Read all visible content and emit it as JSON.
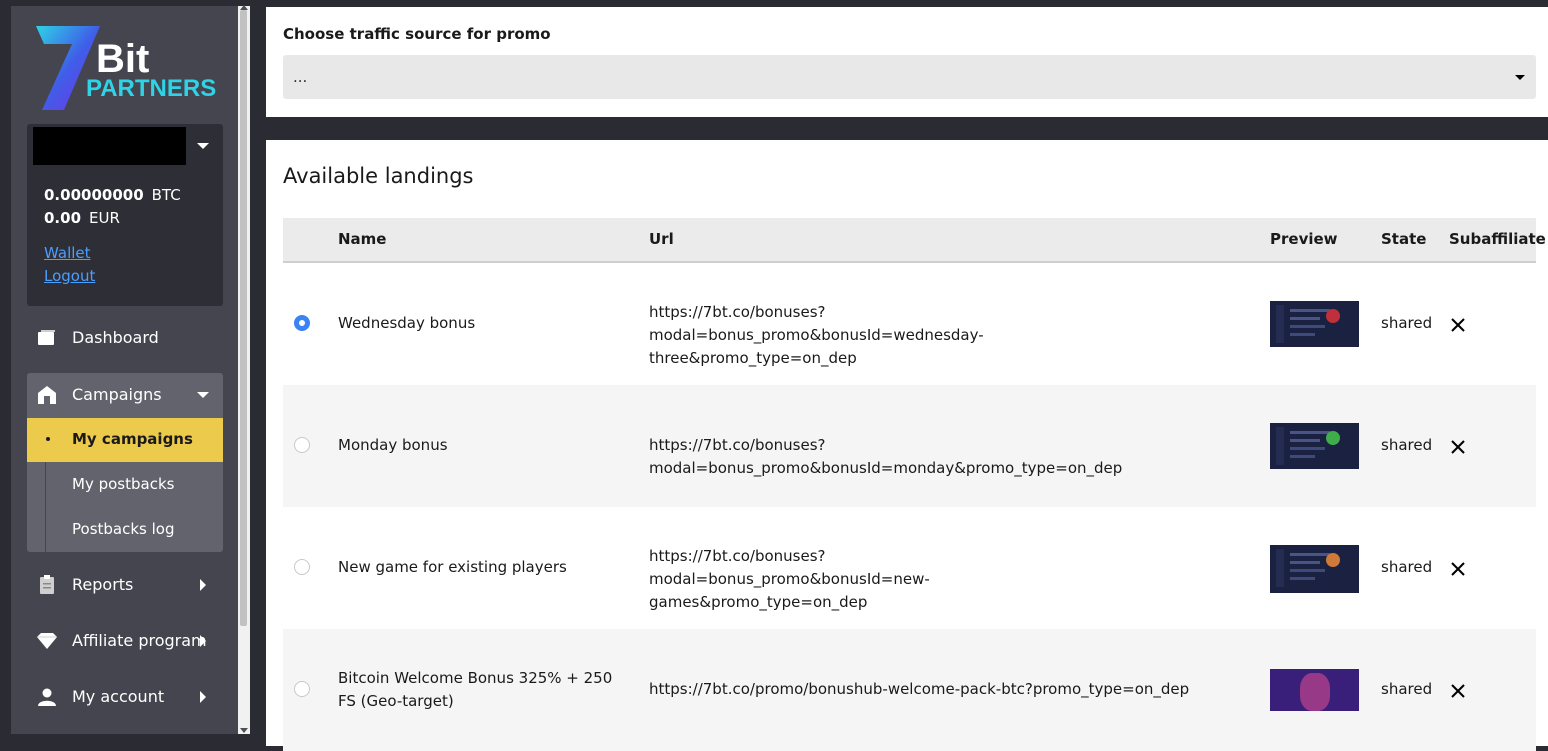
{
  "sidebar": {
    "logo": {
      "line1": "Bit",
      "line2": "PARTNERS",
      "mark": "7"
    },
    "account": {
      "btc_amount": "0.00000000",
      "btc_currency": "BTC",
      "eur_amount": "0.00",
      "eur_currency": "EUR",
      "wallet_link": "Wallet",
      "logout_link": "Logout"
    },
    "nav": {
      "dashboard": "Dashboard",
      "campaigns": "Campaigns",
      "my_campaigns": "My campaigns",
      "my_postbacks": "My postbacks",
      "postbacks_log": "Postbacks log",
      "reports": "Reports",
      "affiliate_program": "Affiliate program",
      "my_account": "My account"
    }
  },
  "traffic": {
    "label": "Choose traffic source for promo",
    "selected": "..."
  },
  "landings": {
    "title": "Available landings",
    "columns": {
      "name": "Name",
      "url": "Url",
      "preview": "Preview",
      "state": "State",
      "subaffiliate": "Subaffiliate"
    },
    "rows": [
      {
        "name": "Wednesday bonus",
        "url": "https://7bt.co/bonuses?modal=bonus_promo&bonusId=wednesday-three&promo_type=on_dep",
        "state": "shared",
        "selected": true
      },
      {
        "name": "Monday bonus",
        "url": "https://7bt.co/bonuses?modal=bonus_promo&bonusId=monday&promo_type=on_dep",
        "state": "shared",
        "selected": false
      },
      {
        "name": "New game for existing players",
        "url": "https://7bt.co/bonuses?modal=bonus_promo&bonusId=new-games&promo_type=on_dep",
        "state": "shared",
        "selected": false
      },
      {
        "name": "Bitcoin Welcome Bonus 325% + 250 FS (Geo-target)",
        "url": "https://7bt.co/promo/bonushub-welcome-pack-btc?promo_type=on_dep",
        "state": "shared",
        "selected": false
      }
    ]
  },
  "colors": {
    "sidebar_bg": "#45454f",
    "active_item": "#ecca4b",
    "link": "#4a9eff",
    "radio_selected": "#3b82f6"
  }
}
